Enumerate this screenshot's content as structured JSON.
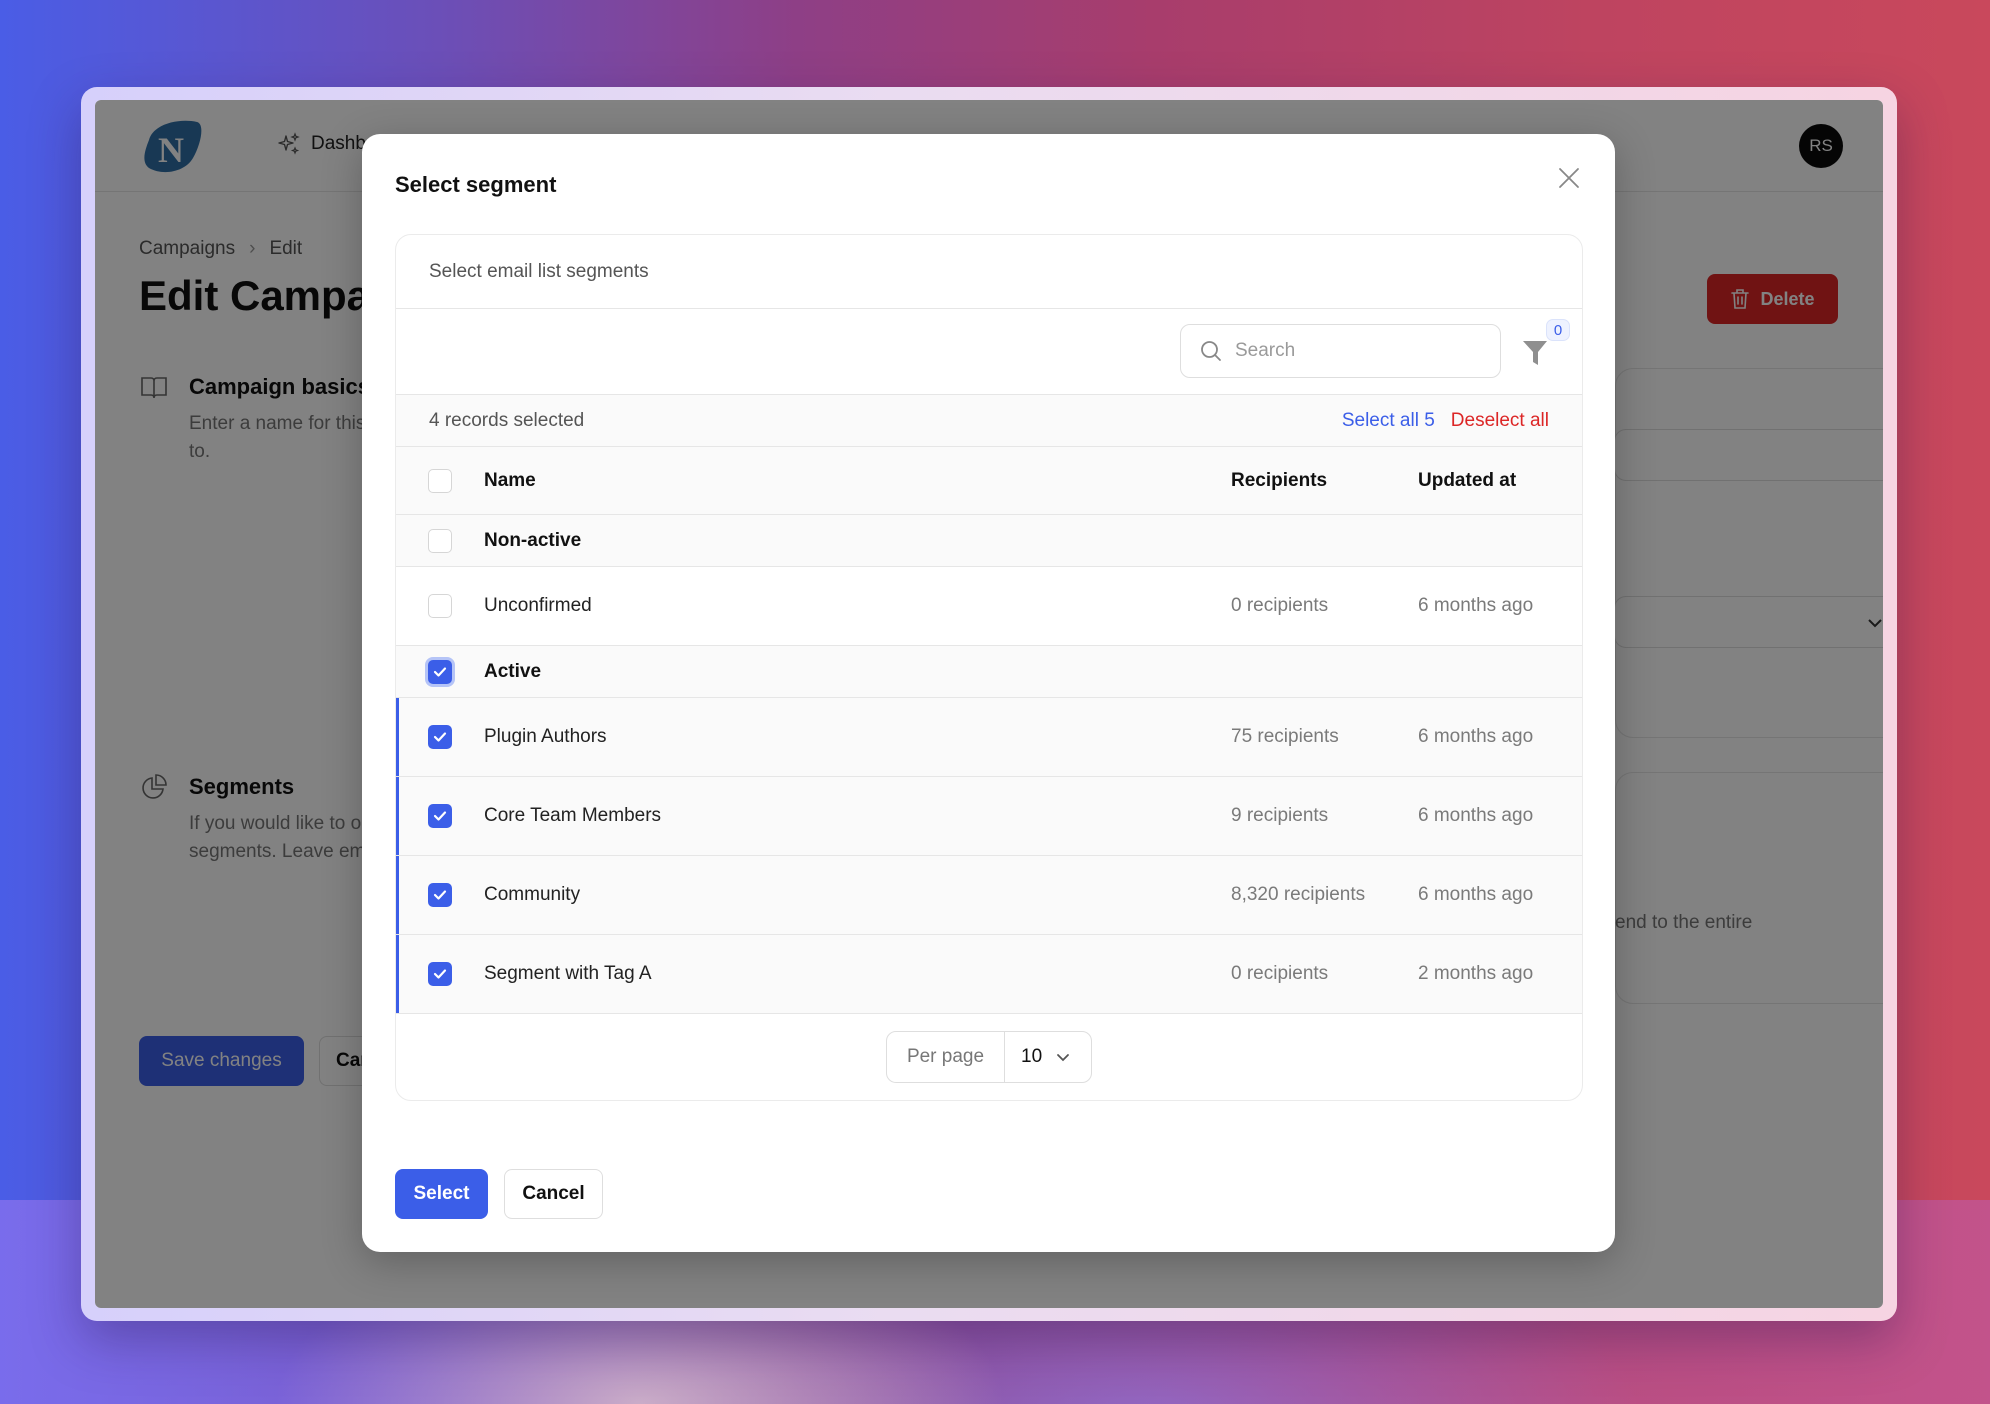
{
  "colors": {
    "accent": "#3b5ee8",
    "danger": "#dc2626",
    "logo": "#2f6fa6"
  },
  "app": {
    "logo_letter": "N",
    "nav": [
      {
        "label": "Dashboard",
        "icon": "sparkles-icon"
      }
    ],
    "avatar_initials": "RS",
    "breadcrumb": [
      "Campaigns",
      "Edit"
    ],
    "page_title": "Edit Campaign",
    "delete_label": "Delete",
    "sections": [
      {
        "title": "Campaign basics",
        "icon": "book-icon",
        "description": "Enter a name for this campaign and choose the email list to send to."
      },
      {
        "title": "Segments",
        "icon": "pie-chart-icon",
        "description": "If you would like to only send to a part of the email list, choose segments. Leave empty to send to the entire email list."
      }
    ],
    "segments_hint_visible": "end to the entire",
    "save_label": "Save changes",
    "cancel_label": "Cancel"
  },
  "modal": {
    "title": "Select segment",
    "panel_heading": "Select email list segments",
    "search": {
      "placeholder": "Search",
      "value": ""
    },
    "filter_count": "0",
    "selection": {
      "text": "4 records selected",
      "select_all_label": "Select all 5",
      "deselect_all_label": "Deselect all"
    },
    "columns": {
      "name": "Name",
      "recipients": "Recipients",
      "updated_at": "Updated at"
    },
    "groups": [
      {
        "label": "Non-active",
        "checked": false,
        "rows": [
          {
            "name": "Unconfirmed",
            "recipients": "0 recipients",
            "updated_at": "6 months ago",
            "checked": false
          }
        ]
      },
      {
        "label": "Active",
        "checked": true,
        "rows": [
          {
            "name": "Plugin Authors",
            "recipients": "75 recipients",
            "updated_at": "6 months ago",
            "checked": true
          },
          {
            "name": "Core Team Members",
            "recipients": "9 recipients",
            "updated_at": "6 months ago",
            "checked": true
          },
          {
            "name": "Community",
            "recipients": "8,320 recipients",
            "updated_at": "6 months ago",
            "checked": true
          },
          {
            "name": "Segment with Tag A",
            "recipients": "0 recipients",
            "updated_at": "2 months ago",
            "checked": true
          }
        ]
      }
    ],
    "pagination": {
      "per_page_label": "Per page",
      "per_page_value": "10"
    },
    "select_label": "Select",
    "cancel_label": "Cancel"
  }
}
